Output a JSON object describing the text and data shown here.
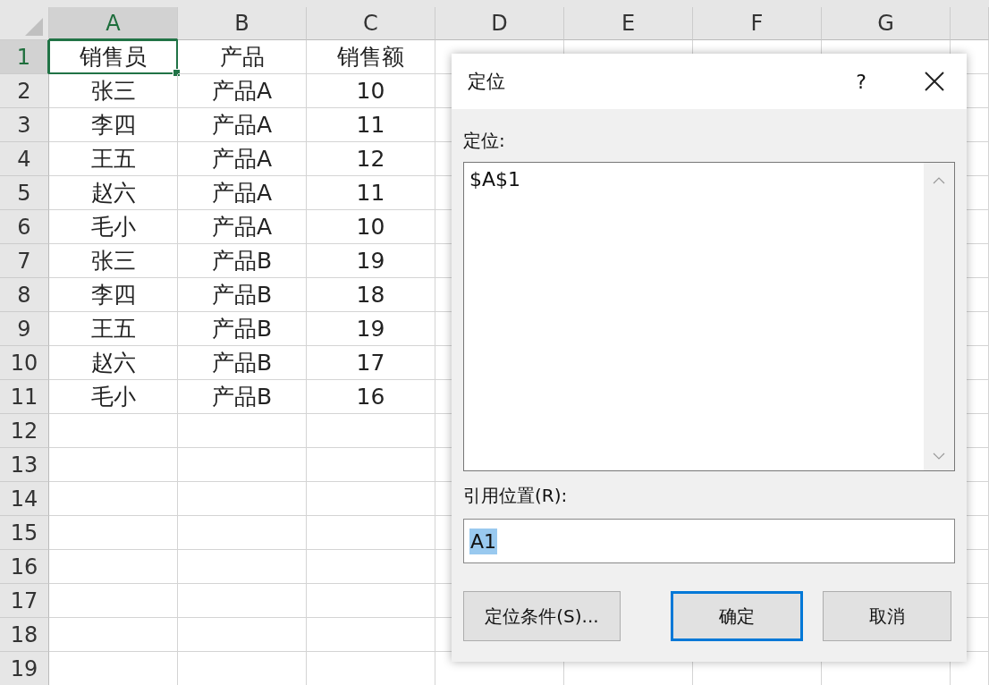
{
  "sheet": {
    "columns": [
      {
        "label": "A"
      },
      {
        "label": "B"
      },
      {
        "label": "C"
      },
      {
        "label": "D"
      },
      {
        "label": "E"
      },
      {
        "label": "F"
      },
      {
        "label": "G"
      }
    ],
    "rows": [
      {
        "header": "1",
        "cells": [
          {
            "text": "销售员",
            "selected": true
          },
          {
            "text": "产品",
            "selected": false
          },
          {
            "text": "销售额",
            "selected": false
          }
        ]
      },
      {
        "header": "2",
        "cells": [
          {
            "text": "张三",
            "selected": false
          },
          {
            "text": "产品A",
            "selected": false
          },
          {
            "text": "10",
            "selected": false
          }
        ]
      },
      {
        "header": "3",
        "cells": [
          {
            "text": "李四",
            "selected": false
          },
          {
            "text": "产品A",
            "selected": false
          },
          {
            "text": "11",
            "selected": false
          }
        ]
      },
      {
        "header": "4",
        "cells": [
          {
            "text": "王五",
            "selected": false
          },
          {
            "text": "产品A",
            "selected": false
          },
          {
            "text": "12",
            "selected": false
          }
        ]
      },
      {
        "header": "5",
        "cells": [
          {
            "text": "赵六",
            "selected": false
          },
          {
            "text": "产品A",
            "selected": false
          },
          {
            "text": "11",
            "selected": false
          }
        ]
      },
      {
        "header": "6",
        "cells": [
          {
            "text": "毛小",
            "selected": false
          },
          {
            "text": "产品A",
            "selected": false
          },
          {
            "text": "10",
            "selected": false
          }
        ]
      },
      {
        "header": "7",
        "cells": [
          {
            "text": "张三",
            "selected": false
          },
          {
            "text": "产品B",
            "selected": false
          },
          {
            "text": "19",
            "selected": false
          }
        ]
      },
      {
        "header": "8",
        "cells": [
          {
            "text": "李四",
            "selected": false
          },
          {
            "text": "产品B",
            "selected": false
          },
          {
            "text": "18",
            "selected": false
          }
        ]
      },
      {
        "header": "9",
        "cells": [
          {
            "text": "王五",
            "selected": false
          },
          {
            "text": "产品B",
            "selected": false
          },
          {
            "text": "19",
            "selected": false
          }
        ]
      },
      {
        "header": "10",
        "cells": [
          {
            "text": "赵六",
            "selected": false
          },
          {
            "text": "产品B",
            "selected": false
          },
          {
            "text": "17",
            "selected": false
          }
        ]
      },
      {
        "header": "11",
        "cells": [
          {
            "text": "毛小",
            "selected": false
          },
          {
            "text": "产品B",
            "selected": false
          },
          {
            "text": "16",
            "selected": false
          }
        ]
      },
      {
        "header": "12"
      },
      {
        "header": "13"
      },
      {
        "header": "14"
      },
      {
        "header": "15"
      },
      {
        "header": "16"
      },
      {
        "header": "17"
      },
      {
        "header": "18"
      },
      {
        "header": "19"
      }
    ]
  },
  "dialog": {
    "title": "定位",
    "help": "?",
    "list_label": "定位:",
    "list_items": [
      "$A$1"
    ],
    "reference_label": "引用位置(R):",
    "reference_value": "A1",
    "reference_value_selected": true,
    "buttons": [
      {
        "label": "定位条件(S)...",
        "default": false
      },
      {
        "label": "确定",
        "default": true
      },
      {
        "label": "取消",
        "default": false
      }
    ]
  }
}
